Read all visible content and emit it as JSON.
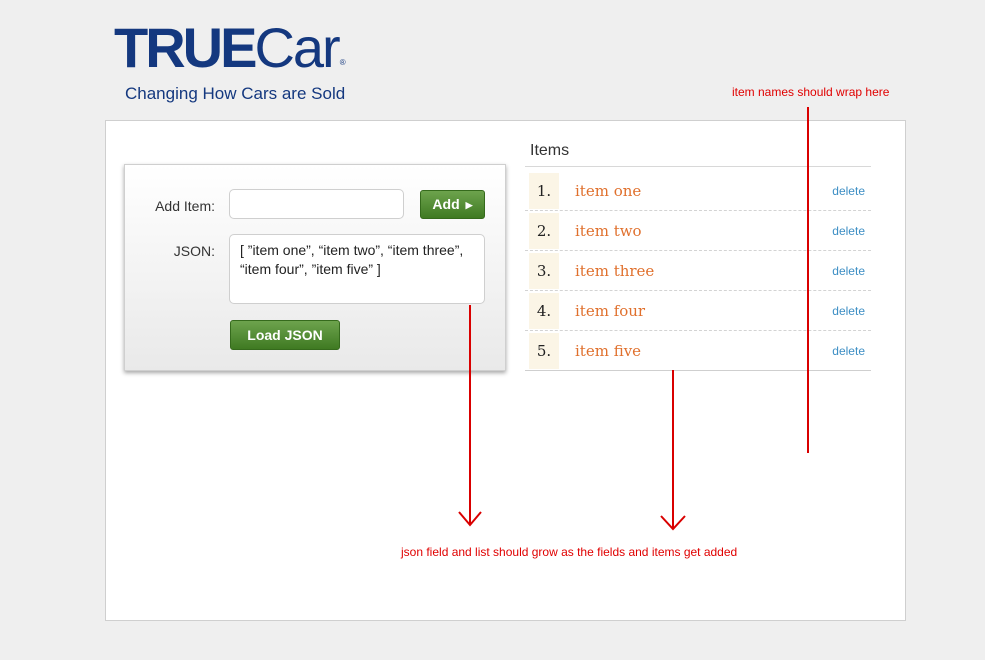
{
  "header": {
    "logo_bold": "TRUE",
    "logo_light": "Car",
    "logo_reg": "®",
    "tagline": "Changing How Cars are Sold"
  },
  "form": {
    "add_label": "Add Item:",
    "add_value": "",
    "add_button": "Add",
    "json_label": "JSON:",
    "json_value": "[ ”item one”, “item two”, “item three”, “item four”, ”item five” ]",
    "load_button": "Load JSON"
  },
  "items": {
    "title": "Items",
    "delete_label": "delete",
    "list": [
      {
        "num": "1.",
        "name": "item one"
      },
      {
        "num": "2.",
        "name": "item two"
      },
      {
        "num": "3.",
        "name": "item three"
      },
      {
        "num": "4.",
        "name": "item four"
      },
      {
        "num": "5.",
        "name": "item five"
      }
    ]
  },
  "annotations": {
    "wrap_note": "item names should wrap here",
    "grow_note": "json field and list should grow as the fields and items get added"
  },
  "colors": {
    "brand_blue": "#14387f",
    "button_green": "#4f8c2f",
    "item_orange": "#e0702d",
    "link_blue": "#3c8ec4",
    "annotation_red": "#d90000"
  }
}
